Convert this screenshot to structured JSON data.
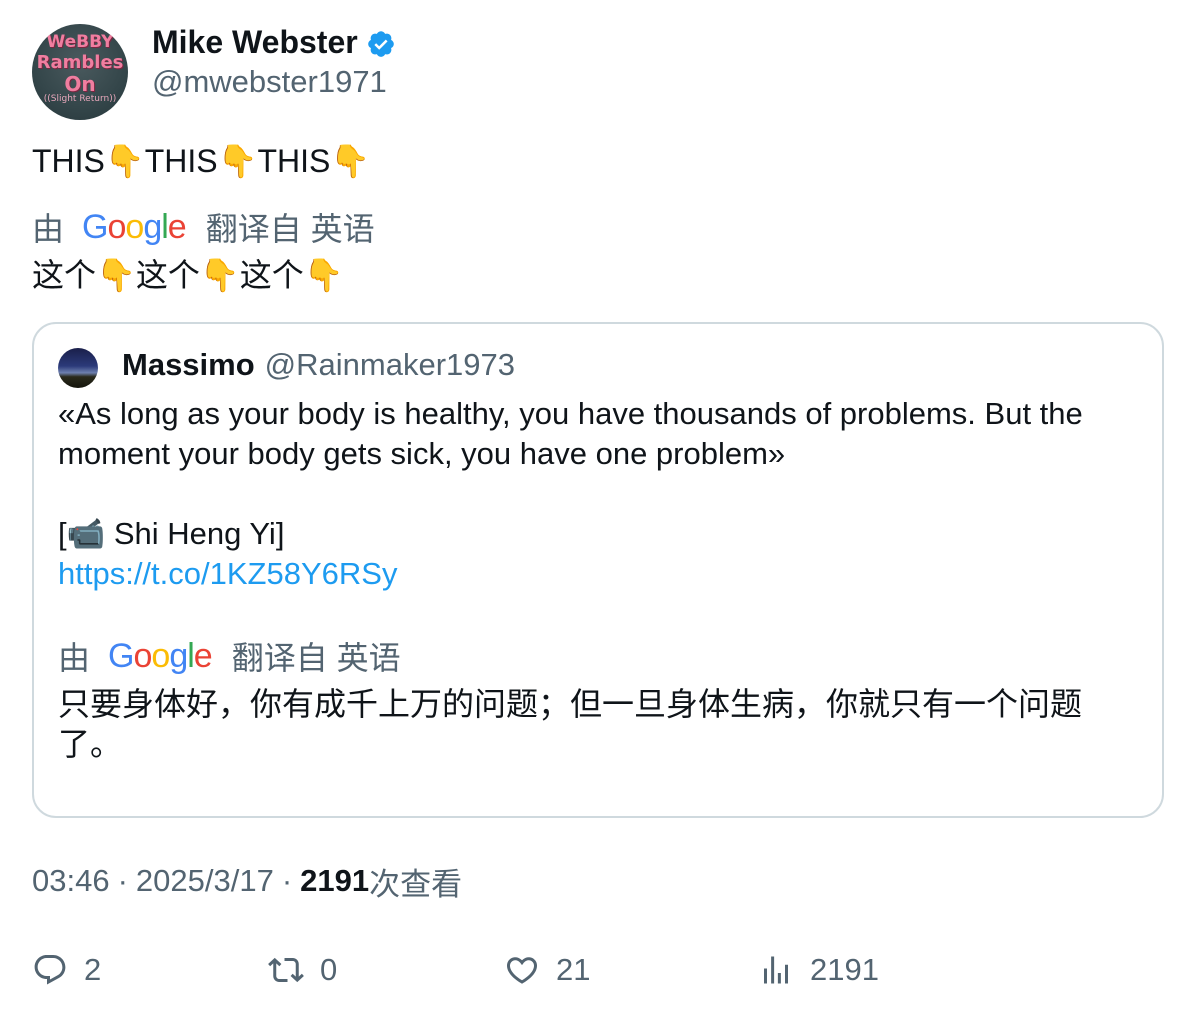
{
  "author": {
    "display_name": "Mike Webster",
    "handle": "@mwebster1971",
    "avatar_text": [
      "WeBBY",
      "Rambles",
      "On",
      "((Slight Return))"
    ]
  },
  "tweet": {
    "text": "THIS👇THIS👇THIS👇",
    "translation_by": "由",
    "translation_provider": "Google",
    "translation_from": "翻译自 英语",
    "translated_text": "这个👇这个👇这个👇"
  },
  "quote": {
    "display_name": "Massimo",
    "handle": "@Rainmaker1973",
    "lines": [
      "«As long as your body is healthy, you have thousands of problems. But the",
      "moment your body gets sick, you have one problem»",
      "",
      "[📹 Shi Heng Yi]"
    ],
    "link": "https://t.co/1KZ58Y6RSy",
    "translation_by": "由",
    "translation_provider": "Google",
    "translation_from": "翻译自 英语",
    "translated_text": "只要身体好，你有成千上万的问题；但一旦身体生病，你就只有一个问题了。"
  },
  "meta": {
    "time": "03:46",
    "separator": "·",
    "date": "2025/3/17",
    "views_count": "2191",
    "views_label": "次查看"
  },
  "actions": {
    "replies": "2",
    "retweets": "0",
    "likes": "21",
    "views": "2191"
  },
  "colors": {
    "text_primary": "#0f1419",
    "text_secondary": "#536471",
    "link": "#1d9bf0",
    "verified": "#1d9bf0",
    "border": "#cfd9de"
  },
  "icons": [
    "verified-badge-icon",
    "reply-icon",
    "retweet-icon",
    "like-icon",
    "views-icon",
    "google-logo"
  ]
}
